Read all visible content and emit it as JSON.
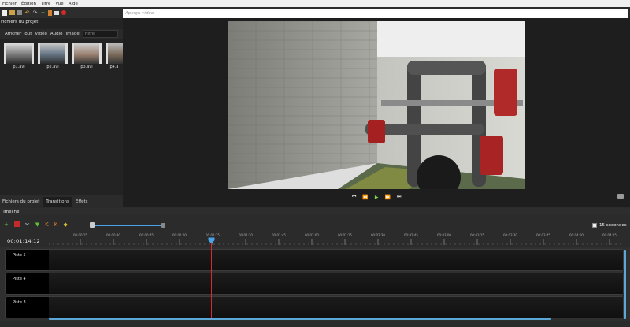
{
  "menu": [
    "Fichier",
    "Édition",
    "Titre",
    "Vue",
    "Aide"
  ],
  "preview_title_placeholder": "Aperçu vidéo",
  "project_files": {
    "title": "Fichiers du projet",
    "filters": [
      "Afficher Tout",
      "Vidéo",
      "Audio",
      "Image"
    ],
    "filter_placeholder": "Filtre",
    "files": [
      "p1.avi",
      "p2.avi",
      "p3.avi",
      "p4.a"
    ]
  },
  "left_tabs": [
    "Fichiers du projet",
    "Transitions",
    "Effets"
  ],
  "timeline": {
    "title": "Timeline",
    "zoom_label": "15 secondes",
    "current_time": "00:01:14:12",
    "ruler": [
      "00:00:15",
      "00:00:30",
      "00:00:45",
      "00:01:00",
      "00:01:15",
      "00:01:30",
      "00:01:45",
      "00:02:00",
      "00:02:15",
      "00:02:30",
      "00:02:45",
      "00:03:00",
      "00:03:15",
      "00:03:30",
      "00:03:45",
      "00:04:00",
      "00:04:15"
    ],
    "tracks": [
      "Piste 5",
      "Piste 4",
      "Piste 3"
    ]
  },
  "colors": {
    "playhead": "#d92b2b",
    "accent": "#5aa7d8",
    "play_green": "#7cd64a"
  },
  "icons": {
    "toolbar": [
      "new-file-icon",
      "open-icon",
      "save-icon",
      "undo-icon",
      "redo-icon",
      "import-icon",
      "export-icon",
      "fullscreen-icon",
      "record-icon"
    ],
    "timeline_toolbar": [
      "add-track-icon",
      "snap-icon",
      "razor-icon",
      "marker-icon",
      "prev-marker-icon",
      "next-marker-icon",
      "center-playhead-icon"
    ]
  }
}
